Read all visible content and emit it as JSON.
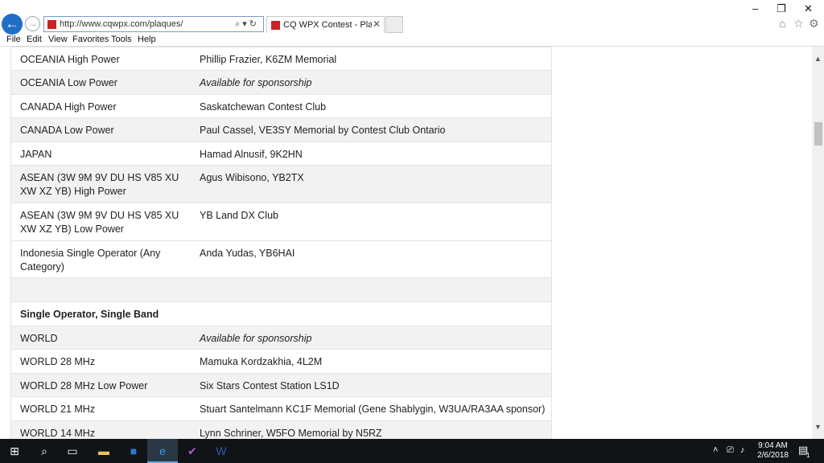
{
  "browser": {
    "url": "http://www.cqwpx.com/plaques/",
    "tab_title": "CQ WPX Contest - Plaques ...",
    "menu": [
      "File",
      "Edit",
      "View",
      "Favorites",
      "Tools",
      "Help"
    ]
  },
  "rows": [
    {
      "category": "OCEANIA High Power",
      "sponsor": "Phillip Frazier, K6ZM Memorial",
      "italic": false,
      "header": false,
      "shade": false
    },
    {
      "category": "OCEANIA Low Power",
      "sponsor": "Available for sponsorship",
      "italic": true,
      "header": false,
      "shade": true
    },
    {
      "category": "CANADA High Power",
      "sponsor": "Saskatchewan Contest Club",
      "italic": false,
      "header": false,
      "shade": false
    },
    {
      "category": "CANADA Low Power",
      "sponsor": "Paul Cassel, VE3SY Memorial by Contest Club Ontario",
      "italic": false,
      "header": false,
      "shade": true
    },
    {
      "category": "JAPAN",
      "sponsor": "Hamad Alnusif, 9K2HN",
      "italic": false,
      "header": false,
      "shade": false
    },
    {
      "category": "ASEAN (3W 9M 9V DU HS V85 XU XW XZ YB) High Power",
      "sponsor": "Agus Wibisono, YB2TX",
      "italic": false,
      "header": false,
      "shade": true
    },
    {
      "category": "ASEAN (3W 9M 9V DU HS V85 XU XW XZ YB) Low Power",
      "sponsor": "YB Land DX Club",
      "italic": false,
      "header": false,
      "shade": false
    },
    {
      "category": "Indonesia Single Operator (Any Category)",
      "sponsor": "Anda Yudas, YB6HAI",
      "italic": false,
      "header": false,
      "shade": false
    },
    {
      "category": "",
      "sponsor": "",
      "italic": false,
      "header": false,
      "shade": true
    },
    {
      "category": "Single Operator, Single Band",
      "sponsor": "",
      "italic": false,
      "header": true,
      "shade": false
    },
    {
      "category": "WORLD",
      "sponsor": "Available for sponsorship",
      "italic": true,
      "header": false,
      "shade": true
    },
    {
      "category": "WORLD 28 MHz",
      "sponsor": "Mamuka Kordzakhia, 4L2M",
      "italic": false,
      "header": false,
      "shade": false
    },
    {
      "category": "WORLD 28 MHz Low Power",
      "sponsor": "Six Stars Contest Station LS1D",
      "italic": false,
      "header": false,
      "shade": true
    },
    {
      "category": "WORLD 21 MHz",
      "sponsor": "Stuart Santelmann KC1F Memorial (Gene Shablygin, W3UA/RA3AA sponsor)",
      "italic": false,
      "header": false,
      "shade": false
    },
    {
      "category": "WORLD 14 MHz",
      "sponsor": "Lynn Schriner, W5FO Memorial by N5RZ",
      "italic": false,
      "header": false,
      "shade": true
    }
  ],
  "taskbar": {
    "time": "9:04 AM",
    "date": "2/6/2018",
    "notification_count": "1"
  }
}
